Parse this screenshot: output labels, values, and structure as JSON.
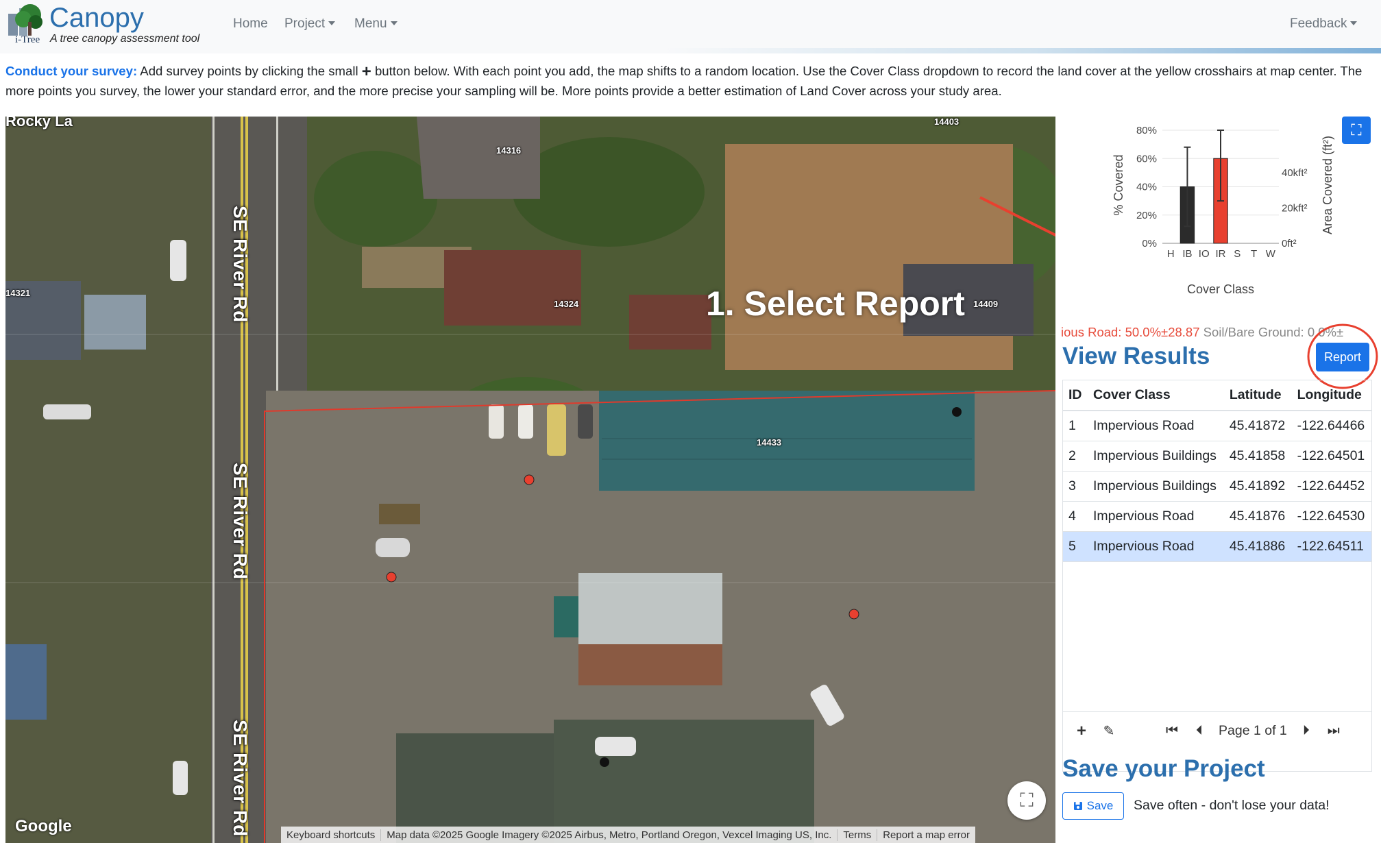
{
  "header": {
    "brand_title": "Canopy",
    "brand_sub": "A tree canopy assessment tool",
    "logo_text": "i-Tree",
    "nav": {
      "home": "Home",
      "project": "Project",
      "menu": "Menu",
      "feedback": "Feedback"
    }
  },
  "instructions": {
    "lead": "Conduct your survey:",
    "part1": " Add survey points by clicking the small ",
    "plus": "+",
    "part2": " button below. With each point you add, the map shifts to a random location. Use the Cover Class dropdown to record the land cover at the yellow crosshairs at map center. The more points you survey, the lower your standard error, and the more precise your sampling will be. More points provide a better estimation of Land Cover across your study area."
  },
  "map": {
    "road_label": "SE River Rd",
    "top_left_label": "Rocky La",
    "parcel_numbers": [
      "14403",
      "14316",
      "14324",
      "14409",
      "14433",
      "14321"
    ],
    "google": "Google",
    "footer": {
      "shortcuts": "Keyboard shortcuts",
      "data": "Map data ©2025 Google Imagery ©2025 Airbus, Metro, Portland Oregon, Vexcel Imaging US, Inc.",
      "terms": "Terms",
      "report_error": "Report a map error"
    },
    "annotation": "1. Select Report",
    "accent_colors": {
      "annotation_arrow": "#e8402f",
      "boundary": "#e03a2c",
      "point_red": "#e8402f",
      "point_black": "#111111"
    }
  },
  "chart_data": {
    "type": "bar",
    "xlabel": "Cover Class",
    "ylabel_left": "% Covered",
    "ylabel_right": "Area Covered (ft²)",
    "categories": [
      "H",
      "IB",
      "IO",
      "IR",
      "S",
      "T",
      "W"
    ],
    "values": [
      0,
      40,
      0,
      60,
      0,
      0,
      0
    ],
    "error": [
      0,
      28,
      0,
      30,
      0,
      0,
      0
    ],
    "ylim": [
      0,
      80
    ],
    "y_ticks": [
      "0%",
      "20%",
      "40%",
      "60%",
      "80%"
    ],
    "y2_ticks": [
      "0ft²",
      "20kft²",
      "40kft²"
    ],
    "colors": {
      "IB": "#2b2b2b",
      "IR": "#e8402f"
    }
  },
  "panel": {
    "summary_red": "ious Road: 50.0%±28.87 ",
    "summary_gray": "Soil/Bare Ground: 0.0%±",
    "view_results": "View Results",
    "report_button": "Report",
    "table": {
      "columns": [
        "ID",
        "Cover Class",
        "Latitude",
        "Longitude"
      ],
      "rows": [
        [
          "1",
          "Impervious Road",
          "45.41872",
          "-122.64466"
        ],
        [
          "2",
          "Impervious Buildings",
          "45.41858",
          "-122.64501"
        ],
        [
          "3",
          "Impervious Buildings",
          "45.41892",
          "-122.64452"
        ],
        [
          "4",
          "Impervious Road",
          "45.41876",
          "-122.64530"
        ],
        [
          "5",
          "Impervious Road",
          "45.41886",
          "-122.64511"
        ]
      ],
      "selected_row": 5
    },
    "pager": {
      "page_text": "Page 1 of 1"
    },
    "save_title": "Save your Project",
    "save_button": "Save",
    "save_note": "Save often - don't lose your data!"
  }
}
